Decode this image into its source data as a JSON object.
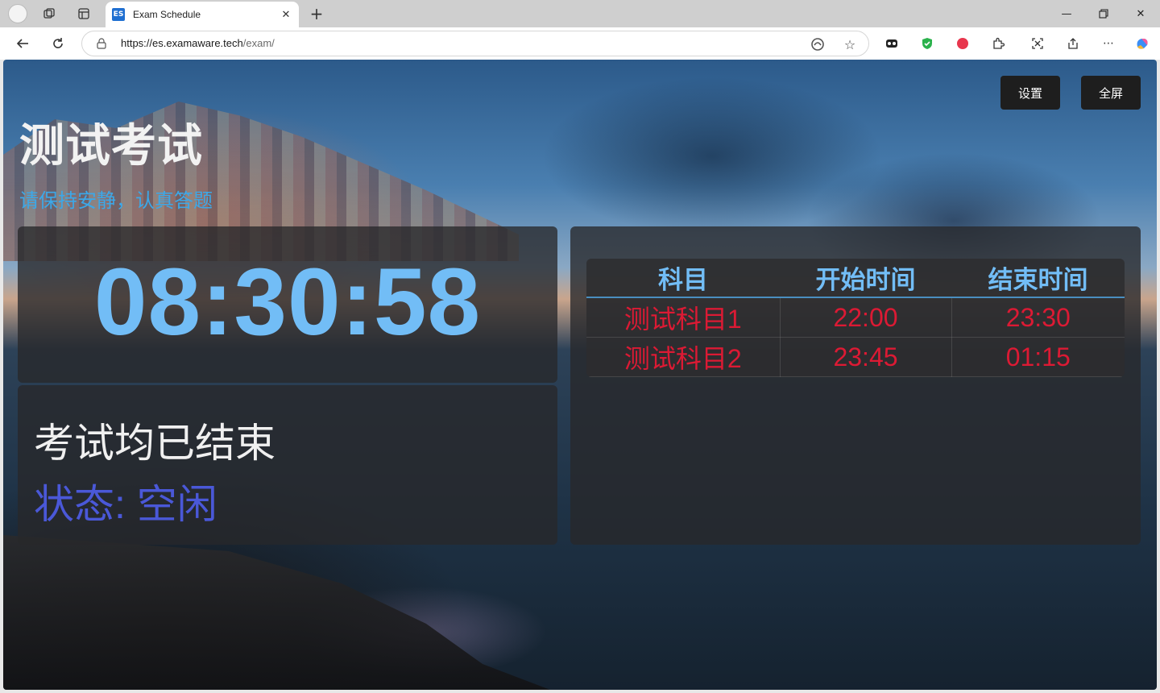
{
  "browser": {
    "tab_title": "Exam Schedule",
    "tab_favicon_text": "ES",
    "url_host": "https://es.examaware.tech",
    "url_path": "/exam/"
  },
  "page": {
    "buttons": {
      "settings": "设置",
      "fullscreen": "全屏"
    },
    "title": "测试考试",
    "subtitle": "请保持安静，认真答题",
    "clock": "08:30:58",
    "status_message": "考试均已结束",
    "status_line": "状态: 空闲",
    "schedule": {
      "headers": [
        "科目",
        "开始时间",
        "结束时间"
      ],
      "rows": [
        [
          "测试科目1",
          "22:00",
          "23:30"
        ],
        [
          "测试科目2",
          "23:45",
          "01:15"
        ]
      ]
    }
  },
  "colors": {
    "clock": "#72bdf6",
    "subtitle": "#3ca8e8",
    "status_line": "#4a58d8",
    "table_cell": "#dc1a34"
  }
}
